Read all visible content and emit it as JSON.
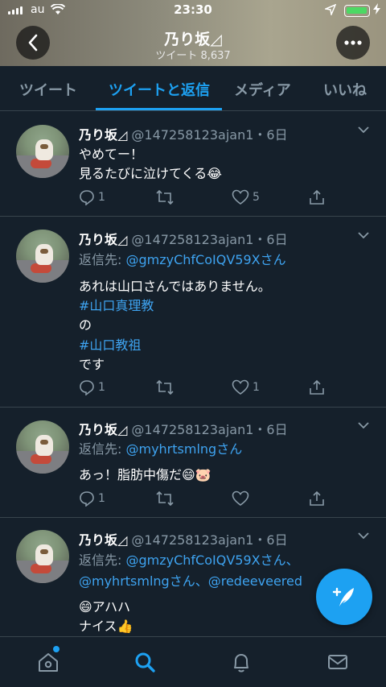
{
  "status_bar": {
    "carrier": "au",
    "time": "23:30"
  },
  "header": {
    "title": "乃り坂◿",
    "subtitle": "ツイート 8,637"
  },
  "tabs": [
    {
      "label": "ツイート",
      "active": false
    },
    {
      "label": "ツイートと返信",
      "active": true
    },
    {
      "label": "メディア",
      "active": false
    },
    {
      "label": "いいね",
      "active": false
    }
  ],
  "tweets": [
    {
      "name": "乃り坂◿",
      "handle_time": "@147258123ajan1・6日",
      "lines": [
        "やめてー！",
        "見るたびに泣けてくる😂"
      ],
      "replies": "1",
      "retweets": "",
      "likes": "5"
    },
    {
      "name": "乃り坂◿",
      "handle_time": "@147258123ajan1・6日",
      "reply_prefix": "返信先: ",
      "reply_to": "@gmzyChfCoIQV59Xさん",
      "lines": [
        "あれは山口さんではありません。",
        "#山口真理教",
        "の",
        "#山口教祖",
        "です"
      ],
      "replies": "1",
      "retweets": "",
      "likes": "1"
    },
    {
      "name": "乃り坂◿",
      "handle_time": "@147258123ajan1・6日",
      "reply_prefix": "返信先: ",
      "reply_to": "@myhrtsmlngさん",
      "lines": [
        "あっ！脂肪中傷だ😄🐷"
      ],
      "replies": "1",
      "retweets": "",
      "likes": ""
    },
    {
      "name": "乃り坂◿",
      "handle_time": "@147258123ajan1・6日",
      "reply_prefix": "返信先: ",
      "reply_to_1": "@gmzyChfCoIQV59Xさん、",
      "reply_to_2": "@myhrtsmlngさん、@redeeveered",
      "lines": [
        "😄アハハ",
        "ナイス👍"
      ]
    }
  ],
  "icons": {
    "back": "chevron-left-icon",
    "more": "more-horizontal-icon",
    "compose": "compose-tweet-icon",
    "home": "home-icon",
    "search": "search-icon",
    "notifications": "bell-icon",
    "messages": "mail-icon"
  },
  "colors": {
    "accent": "#1da1f2",
    "background": "#15202b",
    "muted": "#8899a6"
  }
}
